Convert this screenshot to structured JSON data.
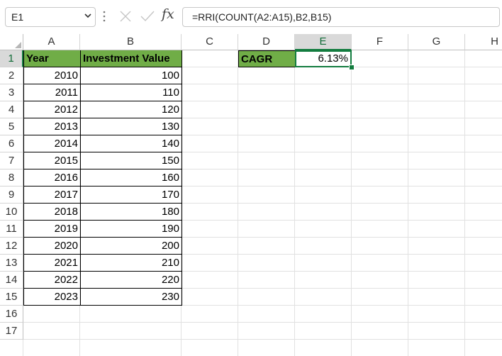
{
  "name_box": {
    "value": "E1"
  },
  "formula_bar": {
    "formula": "=RRI(COUNT(A2:A15),B2,B15)",
    "fx_label": "fx"
  },
  "columns": [
    "A",
    "B",
    "C",
    "D",
    "E",
    "F",
    "G",
    "H"
  ],
  "rows": [
    "1",
    "2",
    "3",
    "4",
    "5",
    "6",
    "7",
    "8",
    "9",
    "10",
    "11",
    "12",
    "13",
    "14",
    "15",
    "16",
    "17"
  ],
  "table": {
    "headers": {
      "year": "Year",
      "value": "Investment Value"
    },
    "years": [
      "2010",
      "2011",
      "2012",
      "2013",
      "2014",
      "2015",
      "2016",
      "2017",
      "2018",
      "2019",
      "2020",
      "2021",
      "2022",
      "2023"
    ],
    "values": [
      "100",
      "110",
      "120",
      "130",
      "140",
      "150",
      "160",
      "170",
      "180",
      "190",
      "200",
      "210",
      "220",
      "230"
    ]
  },
  "cagr": {
    "label": "CAGR",
    "value": "6.13%"
  },
  "selection": {
    "column": "E",
    "row": "1"
  },
  "colors": {
    "header_fill": "#70ad47",
    "selection": "#137c3f"
  }
}
